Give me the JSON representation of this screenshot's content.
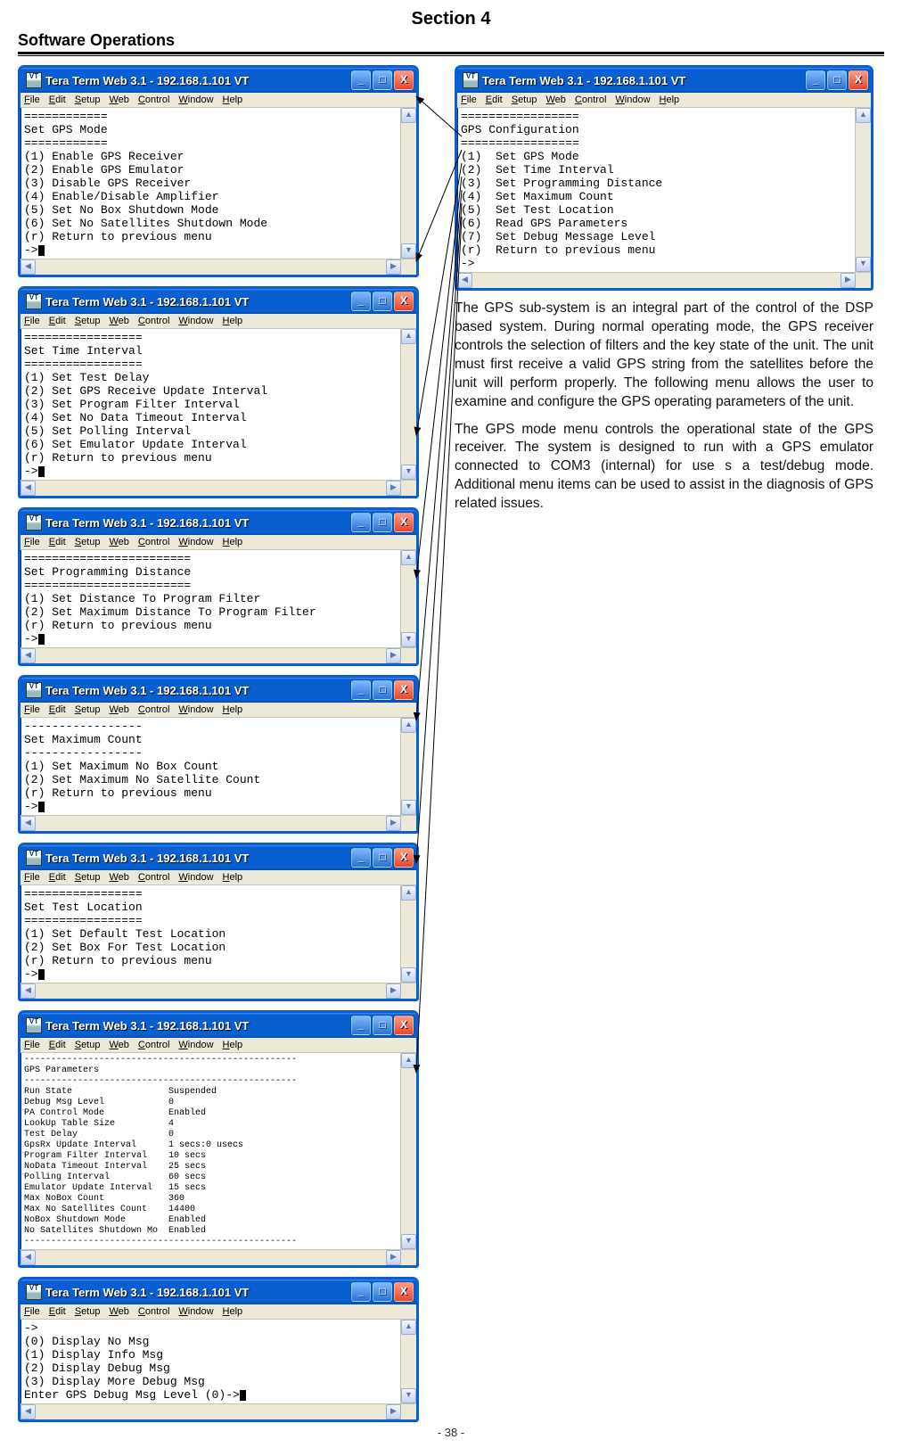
{
  "header": {
    "section": "Section 4",
    "title": "Software Operations"
  },
  "windowTitle": "Tera Term Web 3.1 - 192.168.1.101 VT",
  "menubar": [
    "File",
    "Edit",
    "Setup",
    "Web",
    "Control",
    "Window",
    "Help"
  ],
  "winButtons": {
    "min": "_",
    "max": "□",
    "close": "X"
  },
  "windows": {
    "gpsConfig": "=================\nGPS Configuration\n=================\n(1)  Set GPS Mode\n(2)  Set Time Interval\n(3)  Set Programming Distance\n(4)  Set Maximum Count\n(5)  Set Test Location\n(6)  Read GPS Parameters\n(7)  Set Debug Message Level\n(r)  Return to previous menu\n->",
    "gpsMode": "============\nSet GPS Mode\n============\n(1) Enable GPS Receiver\n(2) Enable GPS Emulator\n(3) Disable GPS Receiver\n(4) Enable/Disable Amplifier\n(5) Set No Box Shutdown Mode\n(6) Set No Satellites Shutdown Mode\n(r) Return to previous menu\n->",
    "timeInterval": "=================\nSet Time Interval\n=================\n(1) Set Test Delay\n(2) Set GPS Receive Update Interval\n(3) Set Program Filter Interval\n(4) Set No Data Timeout Interval\n(5) Set Polling Interval\n(6) Set Emulator Update Interval\n(r) Return to previous menu\n->",
    "progDist": "========================\nSet Programming Distance\n========================\n(1) Set Distance To Program Filter\n(2) Set Maximum Distance To Program Filter\n(r) Return to previous menu\n->",
    "maxCount": "-----------------\nSet Maximum Count\n-----------------\n(1) Set Maximum No Box Count\n(2) Set Maximum No Satellite Count\n(r) Return to previous menu\n->",
    "testLoc": "=================\nSet Test Location\n=================\n(1) Set Default Test Location\n(2) Set Box For Test Location\n(r) Return to previous menu\n->",
    "gpsParams": "---------------------------------------------------\nGPS Parameters\n---------------------------------------------------\nRun State                  Suspended\nDebug Msg Level            0\nPA Control Mode            Enabled\nLookUp Table Size          4\nTest Delay                 0\nGpsRx Update Interval      1 secs:0 usecs\nProgram Filter Interval    10 secs\nNoData Timeout Interval    25 secs\nPolling Interval           60 secs\nEmulator Update Interval   15 secs\nMax NoBox Count            360\nMax No Satellites Count    14400\nNoBox Shutdown Mode        Enabled\nNo Satellites Shutdown Mo  Enabled\n---------------------------------------------------",
    "debugMsg": "->\n(0) Display No Msg\n(1) Display Info Msg\n(2) Display Debug Msg\n(3) Display More Debug Msg\nEnter GPS Debug Msg Level (0)->"
  },
  "paragraphs": {
    "p1": "The GPS sub-system is an integral part of the control of the DSP based system. During normal operating mode, the GPS receiver controls the selection of filters and the key state of the unit. The unit must first receive a valid GPS string from the satellites before the unit will perform properly. The following menu allows the user to examine and configure the GPS operating parameters of the unit.",
    "p2": "The GPS mode menu controls the operational state of the GPS receiver. The system is designed to run with a GPS emulator connected to COM3 (internal) for use s a test/debug mode. Additional menu items can be used to assist in the diagnosis of GPS related issues."
  },
  "pageNumber": "- 38 -"
}
